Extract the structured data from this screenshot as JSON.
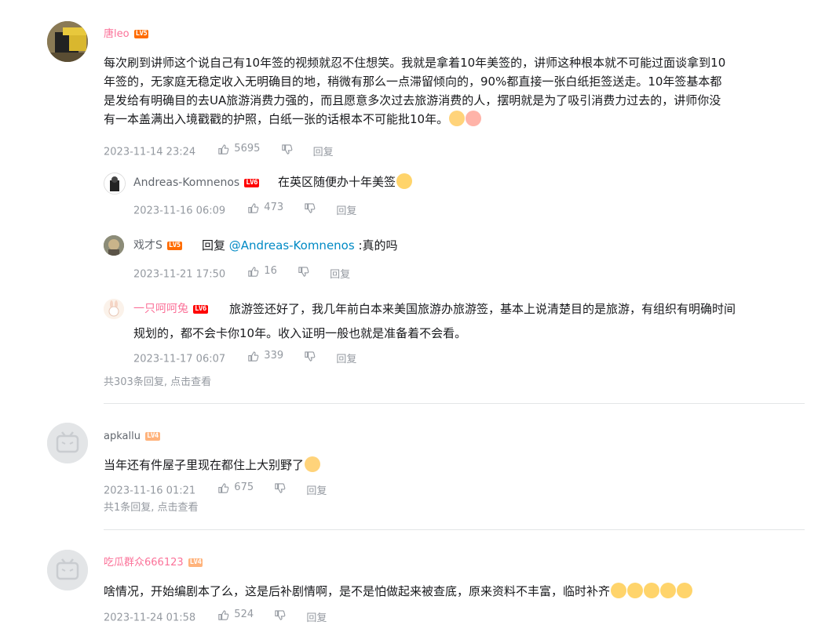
{
  "comments": [
    {
      "username": "唐leo",
      "level": "LV5",
      "content_lines": [
        "每次刷到讲师这个说自己有10年签的视频就忍不住想笑。我就是拿着10年美签的，讲师这种根本就不可能过面谈拿到10",
        "年签的，无家庭无稳定收入无明确目的地，稍微有那么一点滞留倾向的，90%都直接一张白纸拒签送走。10年签基本都",
        "是发给有明确目的去UA旅游消费力强的，而且愿意多次过去旅游消费的人，摆明就是为了吸引消费力过去的，讲师你没",
        "有一本盖满出入境戳戳的护照，白纸一张的话根本不可能批10年。"
      ],
      "time": "2023-11-14 23:24",
      "likes": "5695",
      "reply_label": "回复",
      "replies": [
        {
          "username": "Andreas-Komnenos",
          "level": "LV6",
          "content": "在英区随便办十年美签",
          "time": "2023-11-16 06:09",
          "likes": "473",
          "reply_label": "回复"
        },
        {
          "username": "戏才S",
          "level": "LV5",
          "prefix": "回复 ",
          "mention": "@Andreas-Komnenos",
          "content": " :真的吗",
          "time": "2023-11-21 17:50",
          "likes": "16",
          "reply_label": "回复"
        },
        {
          "username": "一只呵呵兔",
          "level": "LV6",
          "content_lines": [
            "旅游签还好了，我几年前白本来美国旅游办旅游签，基本上说清楚目的是旅游，有组织有明确时间",
            "规划的，都不会卡你10年。收入证明一般也就是准备着不会看。"
          ],
          "time": "2023-11-17 06:07",
          "likes": "339",
          "reply_label": "回复"
        }
      ],
      "more_replies": "共303条回复, 点击查看"
    },
    {
      "username": "apkallu",
      "level": "LV4",
      "content": "当年还有件屋子里现在都住上大别野了",
      "time": "2023-11-16 01:21",
      "likes": "675",
      "reply_label": "回复",
      "more_replies": "共1条回复, 点击查看"
    },
    {
      "username": "吃瓜群众666123",
      "level": "LV4",
      "content": "啥情况，开始编剧本了么，这是后补剧情啊，是不是怕做起来被查底，原来资料不丰富，临时补齐",
      "time": "2023-11-24 01:58",
      "likes": "524",
      "reply_label": "回复"
    }
  ],
  "colors": {
    "pink": "#fb7299",
    "meta": "#9499a0",
    "mention": "#008ac5",
    "divider": "#e3e5e7"
  },
  "icons": [
    "like-icon",
    "dislike-icon",
    "laugh-emoji-icon",
    "cat-emoji-icon",
    "kiss-emoji-icon",
    "cry-emoji-icon"
  ]
}
